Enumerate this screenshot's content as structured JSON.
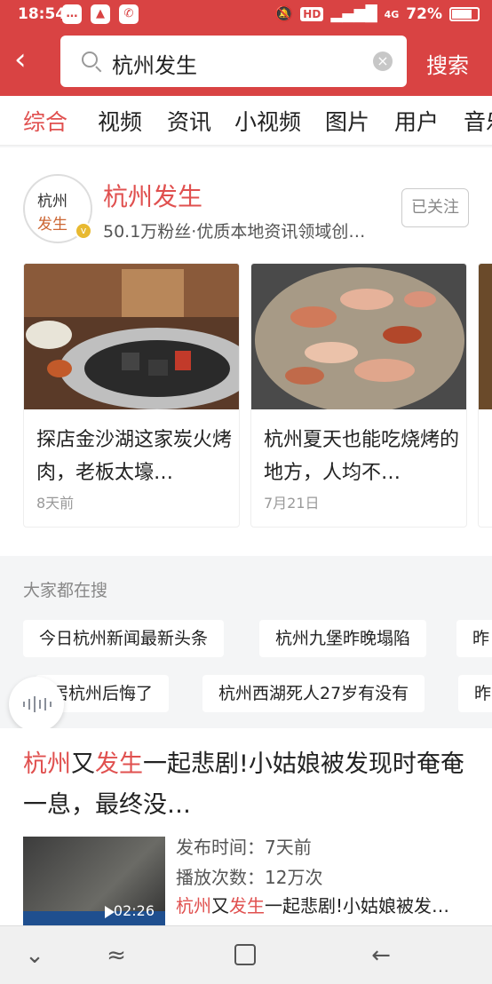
{
  "status_bar": {
    "time": "18:54",
    "network": "HD",
    "signal": "4G",
    "battery": "72%"
  },
  "search_bar": {
    "query": "杭州发生",
    "search_label": "搜索"
  },
  "tabs": [
    "综合",
    "视频",
    "资讯",
    "小视频",
    "图片",
    "用户",
    "音乐"
  ],
  "account": {
    "logo_line1": "杭州",
    "logo_line2": "发生",
    "name": "杭州发生",
    "meta": "50.1万粉丝·优质本地资讯领域创…",
    "follow_label": "已关注"
  },
  "posts": [
    {
      "title": "探店金沙湖这家炭火烤肉，老板太壕…",
      "date": "8天前"
    },
    {
      "title": "杭州夏天也能吃烧烤的地方，人均不…",
      "date": "7月21日"
    }
  ],
  "trending": {
    "heading": "大家都在搜",
    "row1": [
      "今日杭州新闻最新头条",
      "杭州九堡昨晚塌陷",
      "昨"
    ],
    "row2": [
      "居杭州后悔了",
      "杭州西湖死人27岁有没有",
      "昨"
    ]
  },
  "article": {
    "headline_parts": [
      "杭州",
      "又",
      "发生",
      "一起悲剧!小姑娘被发现时奄奄一息，最终没…"
    ],
    "publish_time": "发布时间：7天前",
    "play_count": "播放次数：12万次",
    "snippet_parts": [
      "杭州",
      "又",
      "发生",
      "一起悲剧!小姑娘被发…"
    ],
    "duration": "02:26"
  }
}
